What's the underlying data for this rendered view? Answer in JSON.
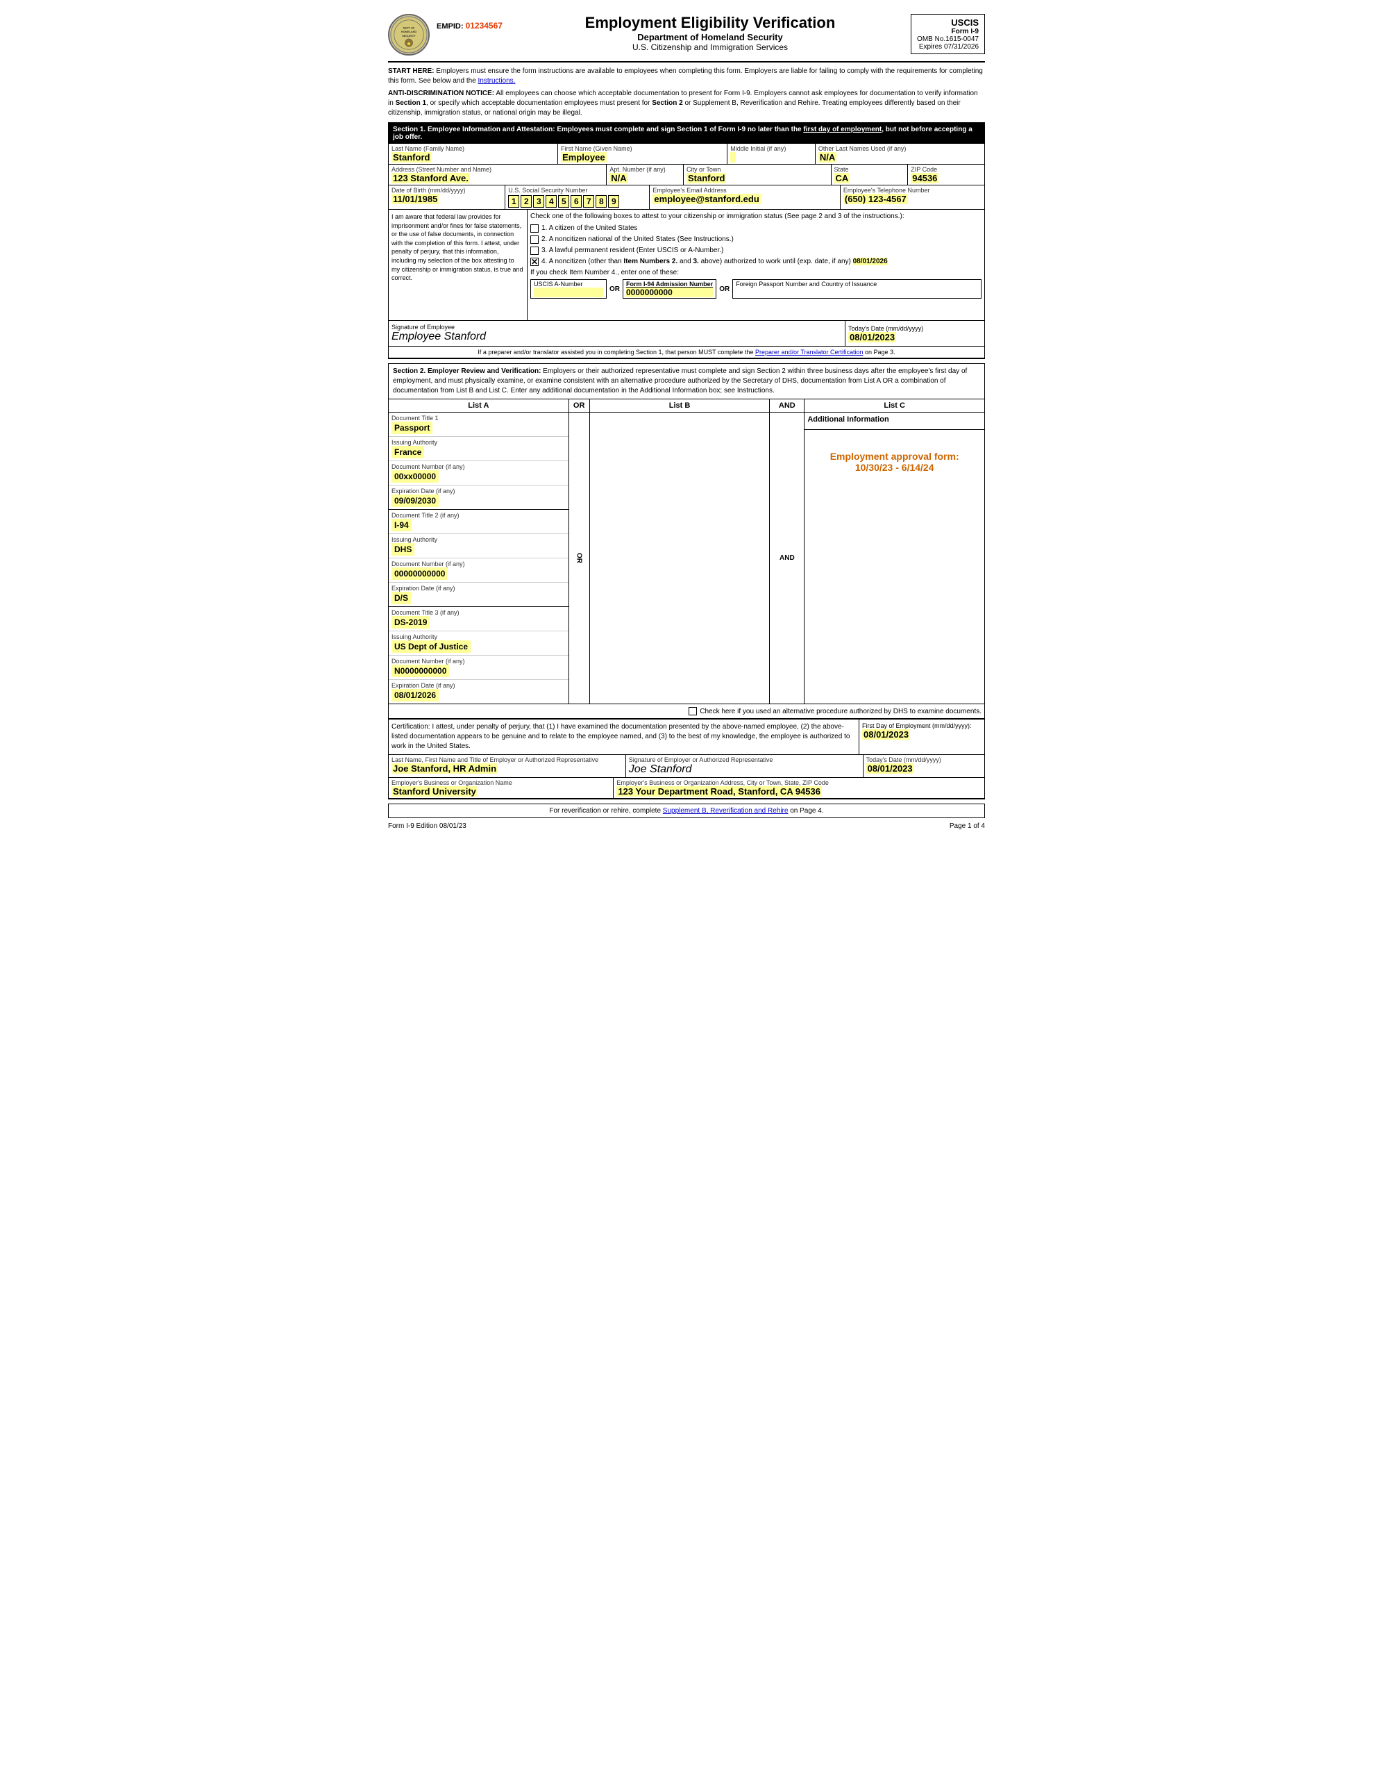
{
  "header": {
    "logo_text": "DEPT OF HOMELAND SECURITY",
    "emp_id_label": "EMPID:",
    "emp_id_value": "01234567",
    "main_title": "Employment Eligibility Verification",
    "subtitle1": "Department of Homeland Security",
    "subtitle2": "U.S. Citizenship and Immigration Services",
    "uscis_title": "USCIS",
    "form_name": "Form I-9",
    "omb_no": "OMB No.1615-0047",
    "expires": "Expires 07/31/2026"
  },
  "notice1": {
    "text": "START HERE: Employers must ensure the form instructions are available to employees when completing this form. Employers are liable for failing to comply with the requirements for completing this form. See below and the Instructions."
  },
  "notice2": {
    "text": "ANTI-DISCRIMINATION NOTICE: All employees can choose which acceptable documentation to present for Form I-9. Employers cannot ask employees for documentation to verify information in Section 1, or specify which acceptable documentation employees must present for Section 2 or Supplement B, Reverification and Rehire. Treating employees differently based on their citizenship, immigration status, or national origin may be illegal."
  },
  "section1": {
    "header": "Section 1. Employee Information and Attestation: Employees must complete and sign Section 1 of Form I-9 no later than the first day of employment, but not before accepting a job offer.",
    "last_name_label": "Last Name (Family Name)",
    "last_name_value": "Stanford",
    "first_name_label": "First Name (Given Name)",
    "first_name_value": "Employee",
    "middle_initial_label": "Middle Initial (if any)",
    "middle_initial_value": "",
    "other_names_label": "Other Last Names Used (if any)",
    "other_names_value": "N/A",
    "address_label": "Address (Street Number and Name)",
    "address_value": "123 Stanford Ave.",
    "apt_label": "Apt. Number (if any)",
    "apt_value": "N/A",
    "city_label": "City or Town",
    "city_value": "Stanford",
    "state_label": "State",
    "state_value": "CA",
    "zip_label": "ZIP Code",
    "zip_value": "94536",
    "dob_label": "Date of Birth (mm/dd/yyyy)",
    "dob_value": "11/01/1985",
    "ssn_label": "U.S. Social Security Number",
    "ssn_digits": [
      "1",
      "2",
      "3",
      "4",
      "5",
      "6",
      "7",
      "8",
      "9"
    ],
    "email_label": "Employee's Email Address",
    "email_value": "employee@stanford.edu",
    "phone_label": "Employee's Telephone Number",
    "phone_value": "(650) 123-4567",
    "attestation_text": "I am aware that federal law provides for imprisonment and/or fines for false statements, or the use of false documents, in connection with the completion of this form. I attest, under penalty of perjury, that this information, including my selection of the box attesting to my citizenship or immigration status, is true and correct.",
    "check_text": "Check one of the following boxes to attest to your citizenship or immigration status (See page 2 and 3 of the instructions.):",
    "option1": "1.  A citizen of the United States",
    "option2": "2.  A noncitizen national of the United States (See Instructions.)",
    "option3": "3.  A lawful permanent resident (Enter USCIS or A-Number.)",
    "option4": "4.  A noncitizen (other than Item Numbers 2. and 3. above) authorized to work until (exp. date, if any)",
    "option4_date": "08/01/2026",
    "option4_note": "If you check Item Number 4., enter one of these:",
    "uscis_a_label": "USCIS A-Number",
    "or_text": "OR",
    "form_i94_label": "Form I-94 Admission Number",
    "form_i94_value": "0000000000",
    "foreign_passport_label": "Foreign Passport Number and Country of Issuance",
    "sig_label": "Signature of Employee",
    "sig_value": "Employee Stanford",
    "date_label": "Today's Date (mm/dd/yyyy)",
    "date_value": "08/01/2023",
    "preparer_note": "If a preparer and/or translator assisted you in completing Section 1, that person MUST complete the Preparer and/or Translator Certification on Page 3."
  },
  "section2": {
    "header_bold": "Section 2. Employer Review and Verification:",
    "header_text": "Employers or their authorized representative must complete and sign Section 2 within three business days after the employee's first day of employment, and must physically examine, or examine consistent with an alternative procedure authorized by the Secretary of DHS, documentation from List A OR a combination of documentation from List B and List C. Enter any additional documentation in the Additional Information box; see Instructions.",
    "list_a_label": "List A",
    "or_label": "OR",
    "list_b_label": "List B",
    "and_label": "AND",
    "list_c_label": "List C",
    "doc1_title_label": "Document Title 1",
    "doc1_title_value": "Passport",
    "issuing_authority_label": "Issuing Authority",
    "doc1_issuing": "France",
    "doc1_num_label": "Document Number (if any)",
    "doc1_num_value": "00xx00000",
    "doc1_exp_label": "Expiration Date (if any)",
    "doc1_exp_value": "09/09/2030",
    "doc2_title_label": "Document Title 2 (if any)",
    "doc2_title_value": "I-94",
    "doc2_issuing": "DHS",
    "doc2_num_label": "Document Number (if any)",
    "doc2_num_value": "00000000000",
    "doc2_exp_label": "Expiration Date (if any)",
    "doc2_exp_value": "D/S",
    "doc3_title_label": "Document Title 3 (if any)",
    "doc3_title_value": "DS-2019",
    "doc3_issuing": "US Dept of Justice",
    "doc3_num_label": "Document Number (if any)",
    "doc3_num_value": "N0000000000",
    "doc3_exp_label": "Expiration Date (if any)",
    "doc3_exp_value": "08/01/2026",
    "add_info_title": "Additional Information",
    "emp_approval": "Employment approval form: 10/30/23 - 6/14/24",
    "alt_proc_text": "Check here if you used an alternative procedure authorized by DHS to examine documents.",
    "cert_text": "Certification: I attest, under penalty of perjury, that (1) I have examined the documentation presented by the above-named employee, (2) the above-listed documentation appears to be genuine and to relate to the employee named, and (3) to the best of my knowledge, the employee is authorized to work in the United States.",
    "first_day_label": "First Day of Employment (mm/dd/yyyy):",
    "first_day_value": "08/01/2023",
    "employer_name_label": "Last Name, First Name and Title of Employer or Authorized Representative",
    "employer_name_value": "Joe Stanford, HR Admin",
    "employer_sig_label": "Signature of Employer or Authorized Representative",
    "employer_sig_value": "Joe Stanford",
    "employer_date_label": "Today's Date (mm/dd/yyyy)",
    "employer_date_value": "08/01/2023",
    "org_name_label": "Employer's Business or Organization Name",
    "org_name_value": "Stanford University",
    "org_address_label": "Employer's Business or Organization Address, City or Town, State, ZIP Code",
    "org_address_value": "123 Your Department Road, Stanford, CA 94536"
  },
  "footer": {
    "reverif_text": "For reverification or rehire, complete Supplement B, Reverification and Rehire on Page 4.",
    "form_edition": "Form I-9  Edition  08/01/23",
    "page_info": "Page 1 of 4"
  }
}
